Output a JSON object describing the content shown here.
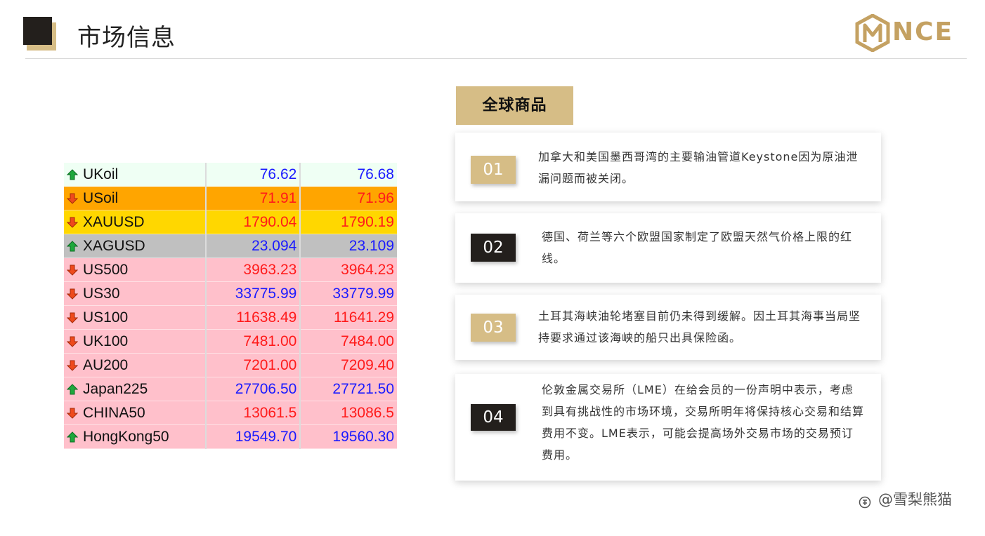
{
  "header": {
    "title": "市场信息",
    "logo_text": "NCE"
  },
  "quotes": [
    {
      "symbol": "UKoil",
      "direction": "up",
      "bid": "76.62",
      "ask": "76.68",
      "bg": "#effff4",
      "value_color": "#1a1aff"
    },
    {
      "symbol": "USoil",
      "direction": "down",
      "bid": "71.91",
      "ask": "71.96",
      "bg": "#ffa500",
      "value_color": "#ff1a1a"
    },
    {
      "symbol": "XAUUSD",
      "direction": "down",
      "bid": "1790.04",
      "ask": "1790.19",
      "bg": "#ffd700",
      "value_color": "#ff1a1a"
    },
    {
      "symbol": "XAGUSD",
      "direction": "up",
      "bid": "23.094",
      "ask": "23.109",
      "bg": "#c0c0c0",
      "value_color": "#1a1aff"
    },
    {
      "symbol": "US500",
      "direction": "down",
      "bid": "3963.23",
      "ask": "3964.23",
      "bg": "#ffc0cb",
      "value_color": "#ff1a1a"
    },
    {
      "symbol": "US30",
      "direction": "down",
      "bid": "33775.99",
      "ask": "33779.99",
      "bg": "#ffc0cb",
      "value_color": "#1a1aff"
    },
    {
      "symbol": "US100",
      "direction": "down",
      "bid": "11638.49",
      "ask": "11641.29",
      "bg": "#ffc0cb",
      "value_color": "#ff1a1a"
    },
    {
      "symbol": "UK100",
      "direction": "down",
      "bid": "7481.00",
      "ask": "7484.00",
      "bg": "#ffc0cb",
      "value_color": "#ff1a1a"
    },
    {
      "symbol": "AU200",
      "direction": "down",
      "bid": "7201.00",
      "ask": "7209.40",
      "bg": "#ffc0cb",
      "value_color": "#ff1a1a"
    },
    {
      "symbol": "Japan225",
      "direction": "up",
      "bid": "27706.50",
      "ask": "27721.50",
      "bg": "#ffc0cb",
      "value_color": "#1a1aff"
    },
    {
      "symbol": "CHINA50",
      "direction": "down",
      "bid": "13061.5",
      "ask": "13086.5",
      "bg": "#ffc0cb",
      "value_color": "#ff1a1a"
    },
    {
      "symbol": "HongKong50",
      "direction": "up",
      "bid": "19549.70",
      "ask": "19560.30",
      "bg": "#ffc0cb",
      "value_color": "#1a1aff"
    }
  ],
  "section": {
    "label": "全球商品"
  },
  "news": [
    {
      "number": "01",
      "style": "gold",
      "text": "加拿大和美国墨西哥湾的主要输油管道Keystone因为原油泄漏问题而被关闭。"
    },
    {
      "number": "02",
      "style": "dark",
      "text": "德国、荷兰等六个欧盟国家制定了欧盟天然气价格上限的红线。"
    },
    {
      "number": "03",
      "style": "gold",
      "text": "土耳其海峡油轮堵塞目前仍未得到缓解。因土耳其海事当局坚持要求通过该海峡的船只出具保险函。"
    },
    {
      "number": "04",
      "style": "dark",
      "text": "伦敦金属交易所（LME）在给会员的一份声明中表示，考虑到具有挑战性的市场环境，交易所明年将保持核心交易和结算费用不变。LME表示，可能会提高场外交易市场的交易预订费用。"
    }
  ],
  "watermark": {
    "icon": "zhihu-icon",
    "text": "@雪梨熊猫"
  },
  "colors": {
    "gold": "#d6bd86",
    "dark": "#231f1c",
    "up": "#1a1aff",
    "down": "#ff1a1a"
  }
}
